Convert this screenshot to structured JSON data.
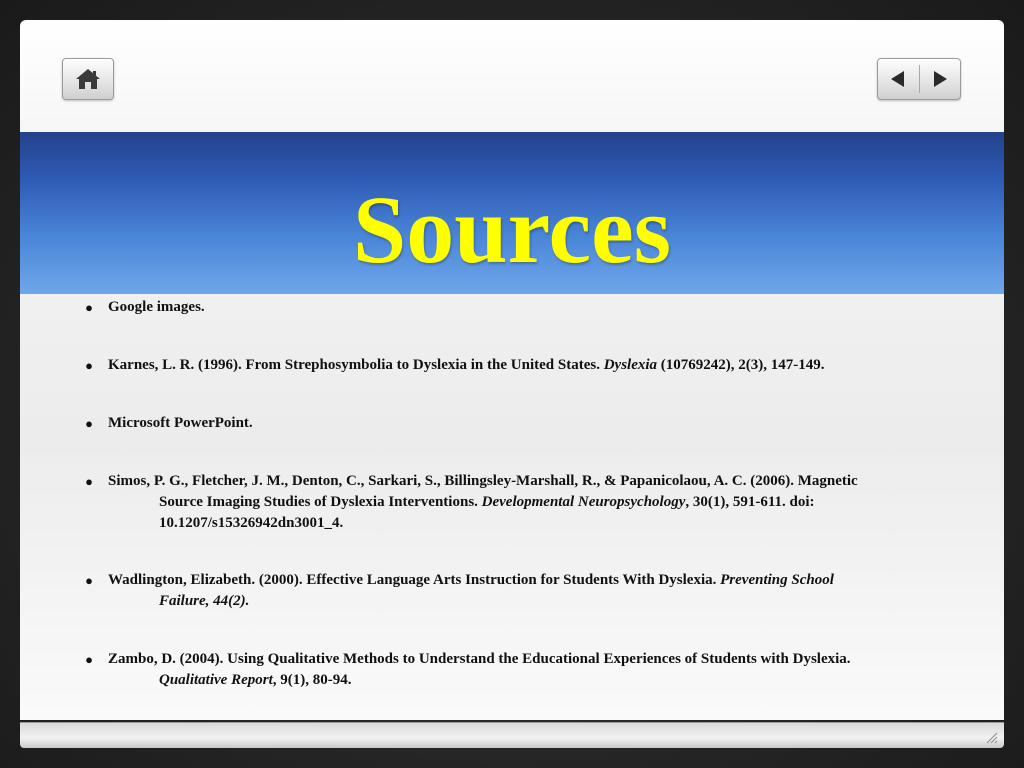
{
  "toolbar": {
    "home_icon": "home-icon",
    "prev_icon": "left-triangle-icon",
    "next_icon": "right-triangle-icon"
  },
  "colors": {
    "title": "#ffff00",
    "band_top": "#23418c",
    "band_bottom": "#6fa7ea"
  },
  "title": "Sources",
  "sources": [
    {
      "l1": "Google images."
    },
    {
      "l1a": "Karnes, L. R. (1996). From Strephosymbolia to Dyslexia in the United States.  ",
      "l1i": "Dyslexia",
      "l1b": " (10769242), 2(3), 147-149."
    },
    {
      "l1": "Microsoft PowerPoint."
    },
    {
      "l1": "Simos, P. G., Fletcher, J. M., Denton, C., Sarkari, S., Billingsley-Marshall, R., & Papanicolaou, A. C. (2006).  Magnetic",
      "l2a": "Source Imaging Studies of Dyslexia Interventions.  ",
      "l2i": "Developmental Neuropsychology",
      "l2b": ", 30(1), 591-611. doi:",
      "l3": "10.1207/s15326942dn3001_4."
    },
    {
      "l1a": "Wadlington, Elizabeth. (2000). Effective Language Arts Instruction for Students With Dyslexia.  ",
      "l1i": "Preventing School",
      "l2i": "Failure, 44(2)."
    },
    {
      "l1": "Zambo, D. (2004). Using Qualitative Methods to Understand the Educational Experiences of Students with Dyslexia.",
      "l2i": "Qualitative Report",
      "l2b": ", 9(1), 80-94."
    }
  ]
}
